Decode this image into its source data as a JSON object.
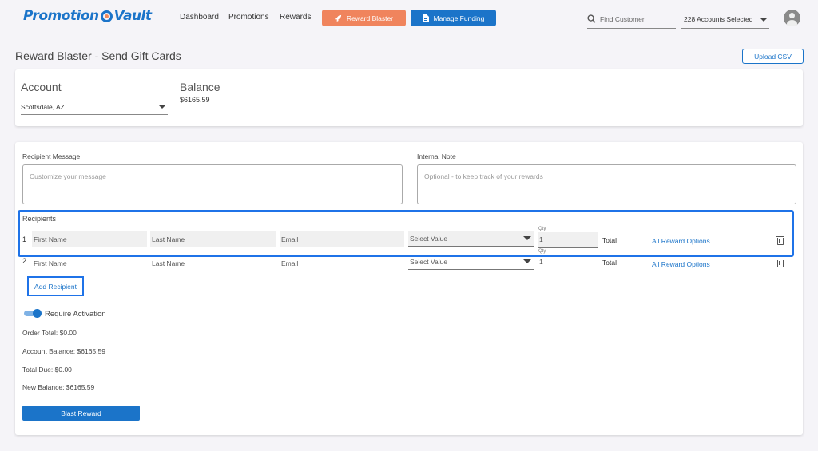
{
  "header": {
    "logo": {
      "part1": "Promotion",
      "part2": "Vault"
    },
    "nav": [
      "Dashboard",
      "Promotions",
      "Rewards"
    ],
    "reward_blaster_label": "Reward Blaster",
    "manage_funding_label": "Manage Funding",
    "search_placeholder": "Find Customer",
    "accounts_selected": "228 Accounts Selected",
    "icons": [
      "rocket-icon",
      "document-icon",
      "search-icon",
      "chevron-down-icon",
      "user-avatar-icon"
    ],
    "colors": {
      "brand_blue": "#1b74c9",
      "accent_orange": "#f0845d"
    }
  },
  "page": {
    "title": "Reward Blaster - Send Gift Cards",
    "upload_csv_label": "Upload CSV"
  },
  "account_card": {
    "account_label": "Account",
    "account_value": "Scottsdale, AZ",
    "balance_label": "Balance",
    "balance_value": "$6165.59"
  },
  "form": {
    "recipient_message_label": "Recipient Message",
    "recipient_message_placeholder": "Customize your message",
    "internal_note_label": "Internal Note",
    "internal_note_placeholder": "Optional - to keep track of your rewards",
    "recipients_label": "Recipients",
    "rows": [
      {
        "num": "1",
        "first_name": "First Name",
        "last_name": "Last Name",
        "email": "Email",
        "select_value": "Select Value",
        "qty_label": "Qty",
        "qty": "1",
        "total_label": "Total",
        "reward_options": "All Reward Options"
      },
      {
        "num": "2",
        "first_name": "First Name",
        "last_name": "Last Name",
        "email": "Email",
        "select_value": "Select Value",
        "qty_label": "Qty",
        "qty": "1",
        "total_label": "Total",
        "reward_options": "All Reward Options"
      }
    ],
    "add_recipient_label": "Add Recipient",
    "require_activation_label": "Require Activation",
    "require_activation_on": true,
    "order_total": "Order Total: $0.00",
    "account_balance": "Account Balance: $6165.59",
    "total_due": "Total Due: $0.00",
    "new_balance": "New Balance: $6165.59",
    "blast_reward_label": "Blast Reward"
  }
}
